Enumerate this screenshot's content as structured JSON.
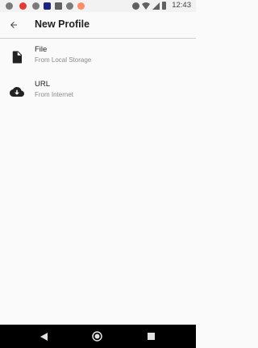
{
  "status_bar": {
    "time": "12:43",
    "icons": [
      "telegram-icon",
      "notification-icon",
      "telegram-icon",
      "app-icon",
      "image-icon",
      "app-icon",
      "app-icon",
      "do-not-disturb-icon",
      "wifi-icon",
      "signal-icon",
      "battery-icon"
    ]
  },
  "app_bar": {
    "title": "New Profile",
    "back_icon": "arrow-back-icon"
  },
  "items": [
    {
      "title": "File",
      "subtitle": "From Local Storage",
      "icon": "file-icon"
    },
    {
      "title": "URL",
      "subtitle": "From Internet",
      "icon": "cloud-download-icon"
    }
  ],
  "nav_bar": {
    "buttons": [
      "back-icon",
      "home-icon",
      "recents-icon"
    ]
  }
}
